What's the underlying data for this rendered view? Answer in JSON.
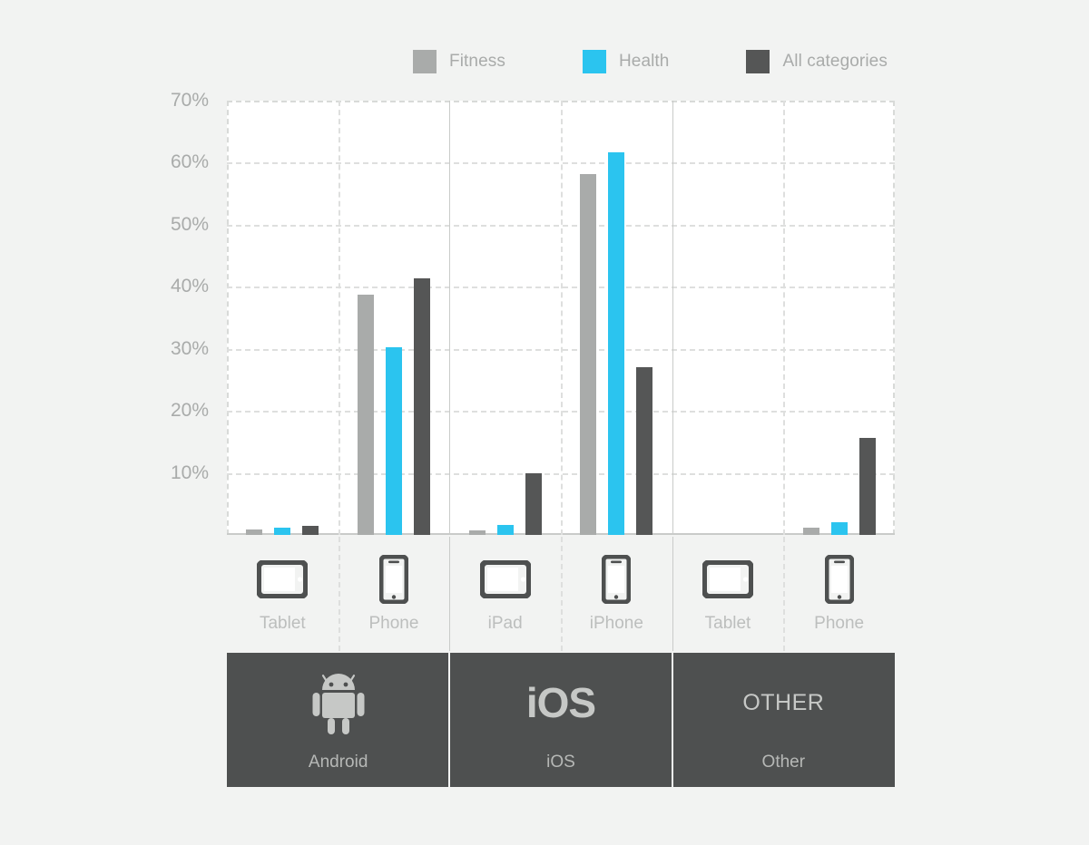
{
  "chart_data": {
    "type": "bar",
    "title": "",
    "xlabel": "",
    "ylabel": "",
    "ylim": [
      0,
      70
    ],
    "grid": true,
    "legend_position": "top-center",
    "categories": [
      "Android Tablet",
      "Android Phone",
      "iOS iPad",
      "iOS iPhone",
      "Other Tablet",
      "Other Phone"
    ],
    "series": [
      {
        "name": "Fitness",
        "color": "#a9abaa",
        "values": [
          0.9,
          38.8,
          0.7,
          58.2,
          0,
          1.1
        ]
      },
      {
        "name": "Health",
        "color": "#2bc4ef",
        "values": [
          1.1,
          30.2,
          1.6,
          61.6,
          0,
          2.1
        ]
      },
      {
        "name": "All categories",
        "color": "#555656",
        "values": [
          1.5,
          41.4,
          10.0,
          27.0,
          0,
          15.7
        ]
      }
    ],
    "yticks": [
      10,
      20,
      30,
      40,
      50,
      60,
      70
    ],
    "ytick_labels": [
      "10%",
      "20%",
      "30%",
      "40%",
      "50%",
      "60%",
      "70%"
    ]
  },
  "legend": {
    "items": [
      {
        "label": "Fitness",
        "color": "#a9abaa",
        "icon": "legend-swatch-fitness"
      },
      {
        "label": "Health",
        "color": "#2bc4ef",
        "icon": "legend-swatch-health"
      },
      {
        "label": "All categories",
        "color": "#555656",
        "icon": "legend-swatch-all-categories"
      }
    ]
  },
  "axis": {
    "ytick_labels": [
      "70%",
      "60%",
      "50%",
      "40%",
      "30%",
      "20%",
      "10%"
    ]
  },
  "devices": [
    {
      "label": "Tablet",
      "icon": "tablet-icon"
    },
    {
      "label": "Phone",
      "icon": "phone-icon"
    },
    {
      "label": "iPad",
      "icon": "tablet-icon"
    },
    {
      "label": "iPhone",
      "icon": "phone-icon"
    },
    {
      "label": "Tablet",
      "icon": "tablet-icon"
    },
    {
      "label": "Phone",
      "icon": "phone-icon"
    }
  ],
  "platforms": [
    {
      "label": "Android",
      "mark": "",
      "mark_type": "android-robot-icon"
    },
    {
      "label": "iOS",
      "mark": "iOS",
      "mark_type": "wordmark"
    },
    {
      "label": "Other",
      "mark": "OTHER",
      "mark_type": "wordmark-plain"
    }
  ],
  "colors": {
    "background": "#f2f3f2",
    "plot_background": "#ffffff",
    "grid": "#dedfde",
    "axis_text": "#a9abaa",
    "platform_band": "#4e5050",
    "fitness": "#a9abaa",
    "health": "#2bc4ef",
    "all_categories": "#555656"
  }
}
